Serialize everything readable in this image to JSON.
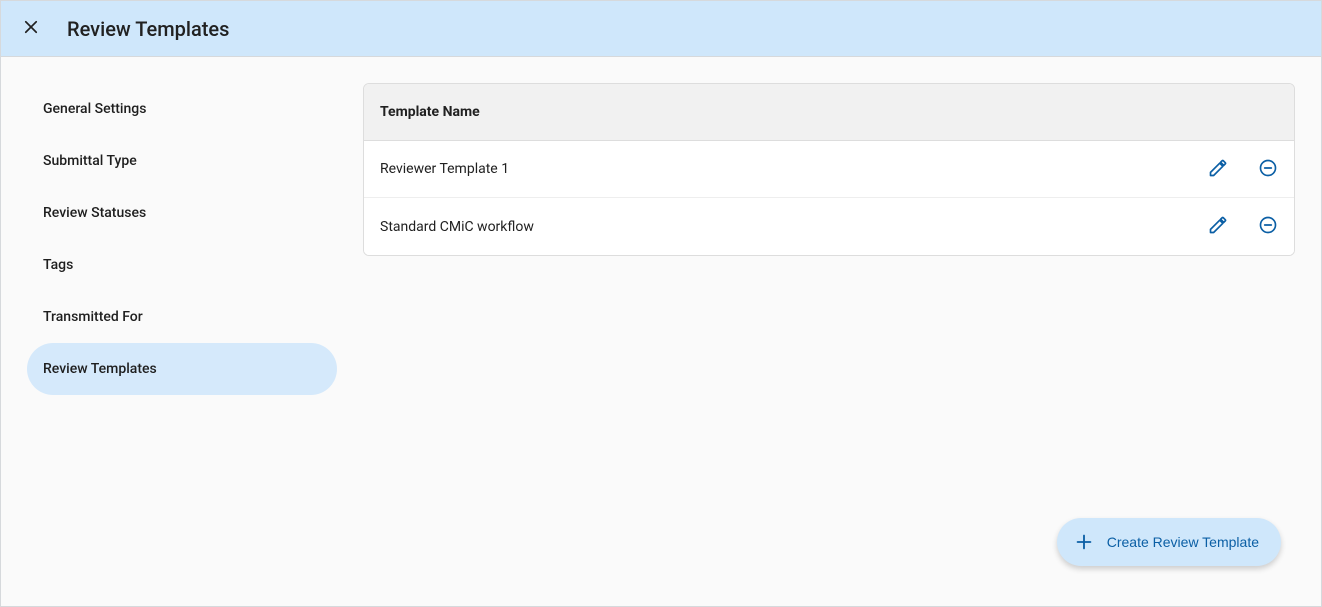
{
  "header": {
    "title": "Review Templates"
  },
  "sidebar": {
    "items": [
      {
        "label": "General Settings",
        "active": false
      },
      {
        "label": "Submittal Type",
        "active": false
      },
      {
        "label": "Review Statuses",
        "active": false
      },
      {
        "label": "Tags",
        "active": false
      },
      {
        "label": "Transmitted For",
        "active": false
      },
      {
        "label": "Review Templates",
        "active": true
      }
    ]
  },
  "table": {
    "header": "Template Name",
    "rows": [
      {
        "name": "Reviewer Template 1"
      },
      {
        "name": "Standard CMiC workflow"
      }
    ]
  },
  "fab": {
    "label": "Create Review Template"
  }
}
